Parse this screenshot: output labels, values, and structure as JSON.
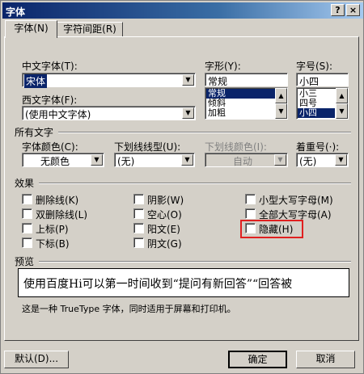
{
  "window": {
    "title": "字体",
    "help_btn": "?",
    "close_btn": "×"
  },
  "tabs": [
    {
      "label": "字体(N)"
    },
    {
      "label": "字符间距(R)"
    }
  ],
  "font": {
    "chinese_label": "中文字体(T):",
    "chinese_value": "宋体",
    "western_label": "西文字体(F):",
    "western_value": "(使用中文字体)",
    "style_label": "字形(Y):",
    "style_value": "常规",
    "style_options": [
      "常规",
      "倾斜",
      "加粗"
    ],
    "size_label": "字号(S):",
    "size_value": "小四",
    "size_options": [
      "小三",
      "四号",
      "小四"
    ]
  },
  "all_text": {
    "section_label": "所有文字",
    "color_label": "字体颜色(C):",
    "color_value": "无颜色",
    "underline_label": "下划线线型(U):",
    "underline_value": "(无)",
    "underline_color_label": "下划线颜色(I):",
    "underline_color_value": "自动",
    "emphasis_label": "着重号(·):",
    "emphasis_value": "(无)"
  },
  "effects": {
    "section_label": "效果",
    "items": [
      {
        "label": "删除线(K)",
        "checked": false
      },
      {
        "label": "双删除线(L)",
        "checked": false
      },
      {
        "label": "上标(P)",
        "checked": false
      },
      {
        "label": "下标(B)",
        "checked": false
      },
      {
        "label": "阴影(W)",
        "checked": false
      },
      {
        "label": "空心(O)",
        "checked": false
      },
      {
        "label": "阳文(E)",
        "checked": false
      },
      {
        "label": "阴文(G)",
        "checked": false
      },
      {
        "label": "小型大写字母(M)",
        "checked": false
      },
      {
        "label": "全部大写字母(A)",
        "checked": false
      },
      {
        "label": "隐藏(H)",
        "checked": false
      }
    ],
    "highlight_color": "#e02020"
  },
  "preview": {
    "section_label": "预览",
    "sample": "使用百度Hi可以第一时间收到“提问有新回答”“回答被",
    "note": "这是一种 TrueType 字体，同时适用于屏幕和打印机。"
  },
  "buttons": {
    "default": "默认(D)...",
    "ok": "确定",
    "cancel": "取消"
  }
}
